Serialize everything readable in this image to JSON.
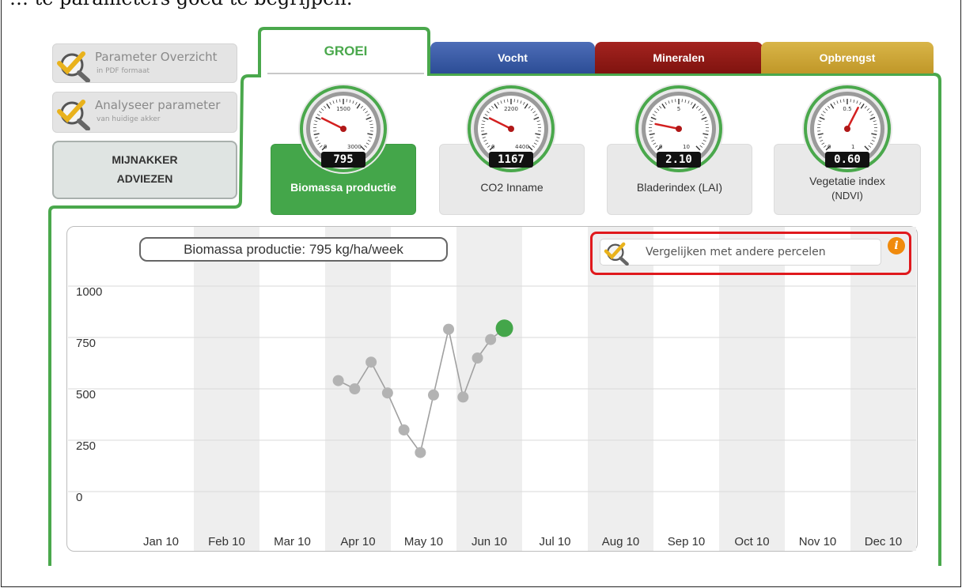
{
  "page": {
    "caption": "… te parameters goed te begrijpen."
  },
  "sidebar": {
    "pdf_title": "Parameter Overzicht",
    "pdf_sub": "in PDF formaat",
    "analyse_title": "Analyseer parameter",
    "analyse_sub": "van huidige akker",
    "advies_line1": "MIJNAKKER",
    "advies_line2": "ADVIEZEN",
    "icon": "magnifier-check-icon"
  },
  "tabs": [
    {
      "label": "GROEI",
      "color": "#4aa84c",
      "active": true
    },
    {
      "label": "Vocht",
      "color": "#34529c",
      "active": false
    },
    {
      "label": "Mineralen",
      "color": "#8e1a15",
      "active": false
    },
    {
      "label": "Opbrengst",
      "color": "#cfa83a",
      "active": false
    }
  ],
  "parameters": [
    {
      "label": "Biomassa productie",
      "label2": "",
      "value": "795",
      "top_tick": "1500",
      "min": "0",
      "max": "3000",
      "fraction": 0.265,
      "active": true
    },
    {
      "label": "CO2 Inname",
      "label2": "",
      "value": "1167",
      "top_tick": "2200",
      "min": "0",
      "max": "4400",
      "fraction": 0.265,
      "active": false
    },
    {
      "label": "Bladerindex (LAI)",
      "label2": "",
      "value": "2.10",
      "top_tick": "5",
      "min": "0",
      "max": "10",
      "fraction": 0.21,
      "active": false
    },
    {
      "label": "Vegetatie index",
      "label2": "(NDVI)",
      "value": "0.60",
      "top_tick": "0.5",
      "min": "0",
      "max": "1",
      "fraction": 0.6,
      "active": false
    }
  ],
  "chart": {
    "title": "Biomassa productie: 795 kg/ha/week",
    "compare_label": "Vergelijken met andere percelen",
    "info_icon": "info-icon"
  },
  "chart_data": {
    "type": "line",
    "title": "Biomassa productie: 795 kg/ha/week",
    "xlabel": "",
    "ylabel": "",
    "ylim": [
      0,
      1000
    ],
    "y_ticks": [
      "1000",
      "750",
      "500",
      "250",
      "0"
    ],
    "x_ticks": [
      "Jan 10",
      "Feb 10",
      "Mar 10",
      "Apr 10",
      "May 10",
      "Jun 10",
      "Jul 10",
      "Aug 10",
      "Sep 10",
      "Oct 10",
      "Nov 10",
      "Dec 10"
    ],
    "grid": true,
    "series": [
      {
        "name": "",
        "color": "#a0a0a0",
        "highlight_color": "#44a64a",
        "points": [
          {
            "x": 3.2,
            "y": 540
          },
          {
            "x": 3.45,
            "y": 500
          },
          {
            "x": 3.7,
            "y": 630
          },
          {
            "x": 3.95,
            "y": 480
          },
          {
            "x": 4.2,
            "y": 300
          },
          {
            "x": 4.45,
            "y": 190
          },
          {
            "x": 4.65,
            "y": 470
          },
          {
            "x": 4.88,
            "y": 790
          },
          {
            "x": 5.1,
            "y": 460
          },
          {
            "x": 5.32,
            "y": 650
          },
          {
            "x": 5.52,
            "y": 740
          },
          {
            "x": 5.73,
            "y": 795
          }
        ]
      }
    ]
  }
}
